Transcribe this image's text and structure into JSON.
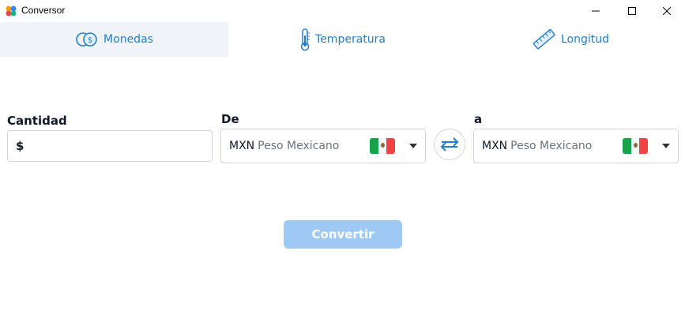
{
  "window": {
    "title": "Conversor"
  },
  "tabs": [
    {
      "label": "Monedas",
      "icon": "coins-icon",
      "active": true
    },
    {
      "label": "Temperatura",
      "icon": "thermometer-icon",
      "active": false
    },
    {
      "label": "Longitud",
      "icon": "ruler-icon",
      "active": false
    }
  ],
  "form": {
    "amount_label": "Cantidad",
    "amount_prefix": "$",
    "amount_value": "",
    "from_label": "De",
    "to_label": "a",
    "from": {
      "code": "MXN",
      "name": "Peso Mexicano",
      "flag": "mexico-flag-icon"
    },
    "to": {
      "code": "MXN",
      "name": "Peso Mexicano",
      "flag": "mexico-flag-icon"
    },
    "convert_label": "Convertir"
  },
  "colors": {
    "accent": "#1e7fd0",
    "button": "#9ec9f4",
    "active_tab": "#f0f4f8"
  }
}
